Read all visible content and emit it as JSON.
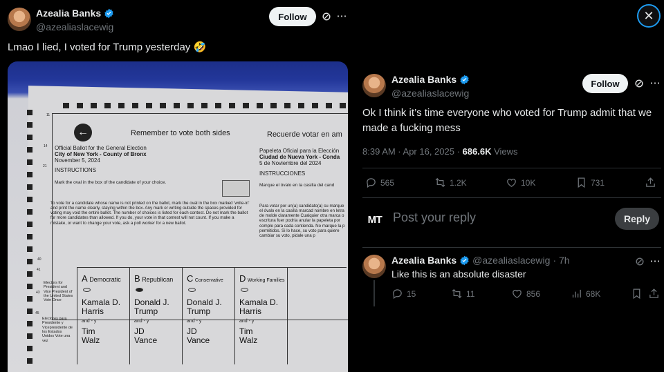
{
  "colors": {
    "accent": "#1d9bf0",
    "verified": "#1d9bf0",
    "background": "#000000",
    "muted": "#71767b"
  },
  "quoted_post": {
    "author_name": "Azealia Banks",
    "author_handle": "@azealiaslacewig",
    "follow_label": "Follow",
    "text": "Lmao I lied, I voted for Trump yesterday 🤣",
    "ballot": {
      "header_en": "Remember to vote both sides",
      "header_es": "Recuerde votar en am",
      "official_en": "Official  Ballot for the General Election",
      "city_en": "City of New York - County of Bronx",
      "date_en": "November 5, 2024",
      "official_es": "Papeleta Oficial para la Elección",
      "city_es": "Ciudad de Nueva York - Conda",
      "date_es": "5 de Noviembre del 2024",
      "instructions_en": "INSTRUCTIONS",
      "instructions_es": "INSTRUCCIONES",
      "mark_en": "Mark the oval in the box of the candidate of your choice.",
      "mark_es": "Marque el óvalo en la casilla del cand",
      "writein_en": "To vote for a candidate whose name is not printed on the ballot, mark the oval in the box marked 'write-in' and print the name clearly, staying within the box. Any mark or writing outside the spaces provided for voting may void the entire ballot. The number of choices is listed for each contest. Do not mark the ballot for more candidates than allowed. If you do, your vote in that contest will not count. If you make a mistake, or want to change your vote, ask a poll worker for a new ballot.",
      "writein_es": "Para votar por un(a) candidato(a) cu marque el óvalo en la casilla marcad nombre en letra de molde claramente Cualquier otra marca o escritura fuer podría anular la papeleta por comple para cada contienda. No marque la p permitidos. Si lo hace, su voto para quiere cambiar su voto, pidale una p",
      "office_en": "Electors for President and Vice President of the United States Vote Once",
      "office_es": "Electores para Presidente y Vicepresidente de los Estados Unidos Vote una vez",
      "row_numbers": [
        "11",
        "14",
        "21",
        "40",
        "41",
        "43",
        "45"
      ],
      "columns": [
        {
          "letter": "A",
          "party": "Democratic",
          "president": "Kamala D. Harris",
          "vp": "Tim Walz"
        },
        {
          "letter": "B",
          "party": "Republican",
          "president": "Donald J. Trump",
          "vp": "JD Vance"
        },
        {
          "letter": "C",
          "party": "Conservative",
          "president": "Donald J. Trump",
          "vp": "JD Vance"
        },
        {
          "letter": "D",
          "party": "Working Families",
          "president": "Kamala D. Harris",
          "vp": "Tim Walz"
        }
      ],
      "and_label": "and - y"
    }
  },
  "main_post": {
    "author_name": "Azealia Banks",
    "author_handle": "@azealiaslacewig",
    "follow_label": "Follow",
    "text": "Ok I think it’s time everyone who voted for Trump admit that we made a fucking mess",
    "time": "8:39 AM · Apr 16, 2025 · ",
    "views_count": "686.6K",
    "views_label": " Views",
    "actions": {
      "replies": "565",
      "reposts": "1.2K",
      "likes": "10K",
      "bookmarks": "731"
    }
  },
  "composer": {
    "avatar_text": "MT",
    "placeholder": "Post your reply",
    "reply_label": "Reply"
  },
  "reply_post": {
    "author_name": "Azealia Banks",
    "author_handle": "@azealiaslacewig",
    "age": "· 7h",
    "text": "Like this is an absolute disaster",
    "actions": {
      "replies": "15",
      "reposts": "11",
      "likes": "856",
      "views": "68K"
    }
  }
}
